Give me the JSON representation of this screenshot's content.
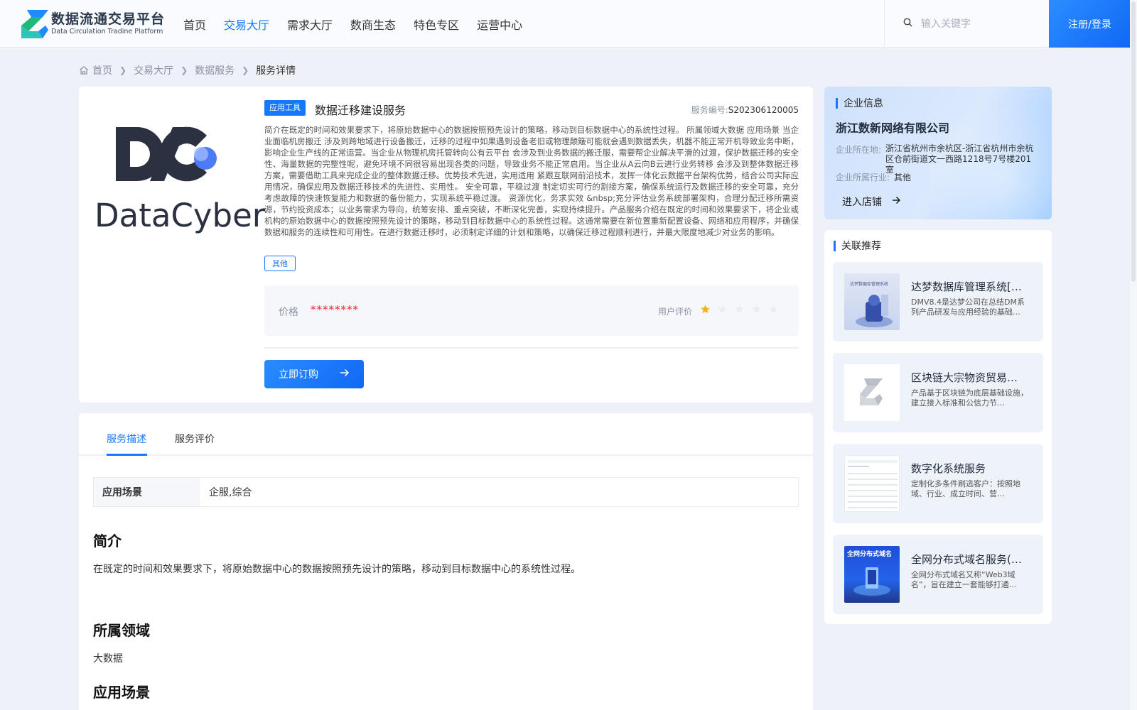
{
  "header": {
    "logo_cn": "数据流通交易平台",
    "logo_en": "Data Circulation Tradine Platform",
    "nav": [
      {
        "label": "首页",
        "active": false
      },
      {
        "label": "交易大厅",
        "active": true
      },
      {
        "label": "需求大厅",
        "active": false
      },
      {
        "label": "数商生态",
        "active": false
      },
      {
        "label": "特色专区",
        "active": false
      },
      {
        "label": "运营中心",
        "active": false
      }
    ],
    "search_placeholder": "输入关键字",
    "login_label": "注册/登录",
    "search_icon": "search-icon"
  },
  "breadcrumb": {
    "home": "首页",
    "level1": "交易大厅",
    "level2": "数据服务",
    "current": "服务详情",
    "home_icon": "home-icon"
  },
  "product": {
    "logo_text": "DataCyber",
    "tag": "应用工具",
    "title": "数据迁移建设服务",
    "service_no_label": "服务编号:",
    "service_no": "S202306120005",
    "description": "简介在既定的时间和效果要求下，将原始数据中心的数据按照预先设计的策略，移动到目标数据中心的系统性过程。 所属领域大数据 应用场景 当企业面临机房搬迁 涉及到跨地域进行设备搬迁，迁移的过程中如果遇到设备老旧或物理颠簸可能就会遇到数据丢失，机器不能正常开机导致业务中断，影响企业生产线的正常运营。当企业从物理机房托管转向公有云平台 会涉及到业务数据的搬迁服，需要帮企业解决平滑的过渡，保护数据迁移的安全性、海量数据的完整性呢，避免环境不同很容易出现各类的问题，导致业务不能正常启用。当企业从A云向B云进行业务转移 会涉及到整体数据迁移方案，需要借助工具来完成企业的整体数据迁移。优势技术先进，实用适用 紧跟互联网前沿技术，发挥一体化云数据平台架构优势，结合公司实际应用情况，确保应用及数据迁移技术的先进性、实用性。 安全可靠，平稳过渡 制定切实可行的割接方案，确保系统运行及数据迁移的安全可靠，充分考虑故障的快速恢复能力和数据的备份能力，实现系统平稳过渡。 资源优化，务求实效 &nbsp;充分评估业务系统部署架构，合理分配迁移所需资源，节约投资成本；以业务需求为导向，统筹安排、重点突破，不断深化完善，实现持续提升。产品服务介绍在既定的时间和效果要求下，将企业或机构的原始数据中心的数据按照预先设计的策略，移动到目标数据中心的系统性过程。这通常需要在新位置重新配置设备、网络和应用程序，并确保数据和服务的连续性和可用性。在进行数据迁移时，必须制定详细的计划和策略，以确保迁移过程顺利进行，并最大限度地减少对业务的影响。",
    "category_tag": "其他",
    "price_label": "价格",
    "price_value": "********",
    "rating_label": "用户评价",
    "rating": 1,
    "rating_max": 5,
    "order_label": "立即订购",
    "colors": {
      "accent": "#1677ff",
      "price": "#f5222d",
      "star_on": "#f5b01a",
      "star_off": "#e9ecf1"
    }
  },
  "details": {
    "tabs": [
      {
        "label": "服务描述",
        "active": true
      },
      {
        "label": "服务评价",
        "active": false
      }
    ],
    "scene_key": "应用场景",
    "scene_val": "企服,综合",
    "sections": [
      {
        "heading": "简介",
        "text": "在既定的时间和效果要求下，将原始数据中心的数据按照预先设计的策略，移动到目标数据中心的系统性过程。"
      },
      {
        "heading": "所属领域",
        "text": "大数据"
      },
      {
        "heading": "应用场景",
        "text": ""
      }
    ]
  },
  "company": {
    "header": "企业信息",
    "name": "浙江数新网络有限公司",
    "location_label": "企业所在地:",
    "location": "浙江省杭州市余杭区-浙江省杭州市余杭区仓前街道文一西路1218号7号楼201室",
    "industry_label": "企业所属行业:",
    "industry": "其他",
    "enter_shop": "进入店铺"
  },
  "recommend": {
    "header": "关联推荐",
    "items": [
      {
        "title": "达梦数据库管理系统[…",
        "desc": "DMV8.4是达梦公司在总结DM系列产品研发与应用经验的基础…",
        "thumb": "dm-thumb",
        "thumb_caption": "达梦数据库管理系统"
      },
      {
        "title": "区块链大宗物资贸易…",
        "desc": "产品基于区块链为底层基础设施，建立接入标准和公信力节…",
        "thumb": "logo-thumb"
      },
      {
        "title": "数字化系统服务",
        "desc": "定制化多条件刷选客户：按照地域、行业、成立时间、营…",
        "thumb": "table-thumb"
      },
      {
        "title": "全网分布式域名服务(…",
        "desc": "全网分布式域名又称“Web3域名”，旨在建立一套能够打通…",
        "thumb": "web3-thumb",
        "thumb_caption": "全网分布式域名"
      }
    ]
  }
}
